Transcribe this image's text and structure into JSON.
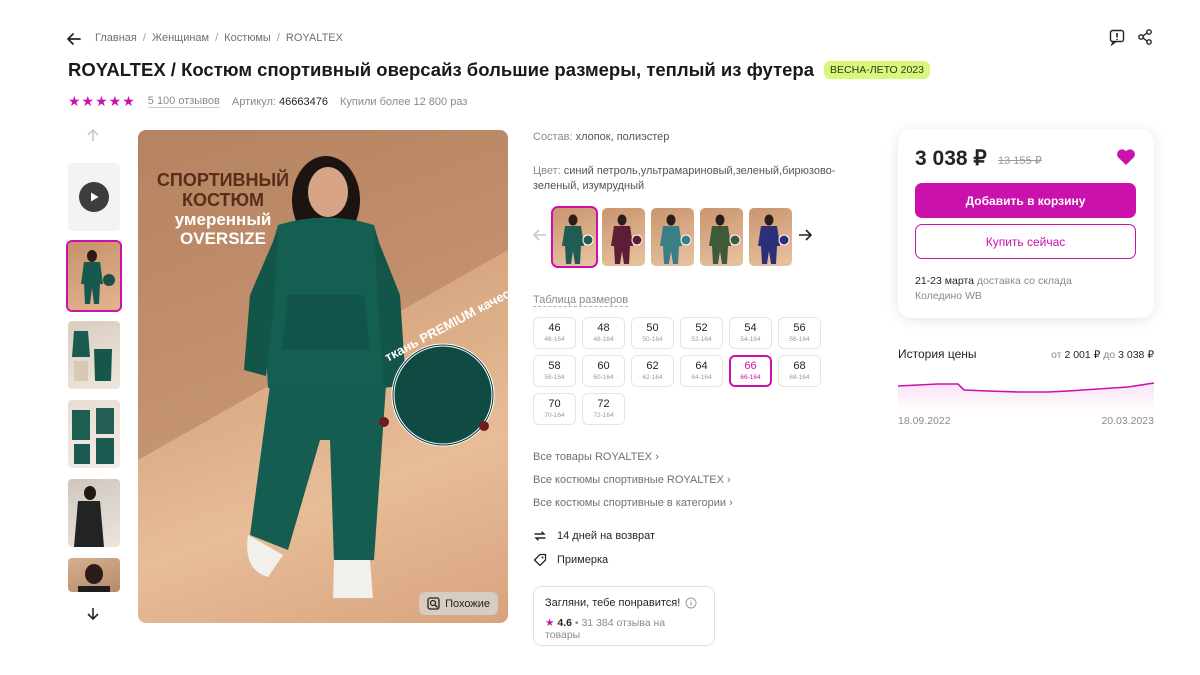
{
  "breadcrumbs": [
    "Главная",
    "Женщинам",
    "Костюмы",
    "ROYALTEX"
  ],
  "title": "ROYALTEX / Костюм спортивный оверсайз большие размеры, теплый из футера",
  "season_badge": "ВЕСНА-ЛЕТО 2023",
  "rating": {
    "stars": 5,
    "reviews": "5 100 отзывов"
  },
  "article": {
    "label": "Артикул:",
    "value": "46663476"
  },
  "bought": "Купили более 12 800 раз",
  "main_image": {
    "promo_lines": [
      "СПОРТИВНЫЙ",
      "КОСТЮМ",
      "умеренный",
      "OVERSIZE"
    ],
    "badge_text": "ткань PREMIUM качества без начеса",
    "similar_button": "Похожие"
  },
  "composition": {
    "label": "Состав:",
    "value": "хлопок, полиэстер"
  },
  "color": {
    "label": "Цвет:",
    "value": "синий петроль,ультрамариновый,зеленый,бирюзово-зеленый, изумрудный"
  },
  "color_variants": [
    {
      "name": "green",
      "color": "#1f5d52",
      "active": true
    },
    {
      "name": "burgundy",
      "color": "#5b1e36",
      "active": false
    },
    {
      "name": "teal",
      "color": "#3b7f86",
      "active": false
    },
    {
      "name": "olive",
      "color": "#3e5a3a",
      "active": false
    },
    {
      "name": "navy",
      "color": "#2c2f7a",
      "active": false
    }
  ],
  "size_table_label": "Таблица размеров",
  "sizes": [
    {
      "n": "46",
      "r": "46-164",
      "selected": false
    },
    {
      "n": "48",
      "r": "48-164",
      "selected": false
    },
    {
      "n": "50",
      "r": "50-164",
      "selected": false
    },
    {
      "n": "52",
      "r": "52-164",
      "selected": false
    },
    {
      "n": "54",
      "r": "54-164",
      "selected": false
    },
    {
      "n": "56",
      "r": "56-164",
      "selected": false
    },
    {
      "n": "58",
      "r": "58-164",
      "selected": false
    },
    {
      "n": "60",
      "r": "60-164",
      "selected": false
    },
    {
      "n": "62",
      "r": "62-164",
      "selected": false
    },
    {
      "n": "64",
      "r": "64-164",
      "selected": false
    },
    {
      "n": "66",
      "r": "66-164",
      "selected": true
    },
    {
      "n": "68",
      "r": "68-164",
      "selected": false
    },
    {
      "n": "70",
      "r": "70-164",
      "selected": false
    },
    {
      "n": "72",
      "r": "72-164",
      "selected": false
    }
  ],
  "links": [
    "Все товары ROYALTEX ›",
    "Все костюмы спортивные ROYALTEX ›",
    "Все костюмы спортивные в категории ›"
  ],
  "features": {
    "return": "14 дней на возврат",
    "fitting": "Примерка"
  },
  "promo_card": {
    "title": "Загляни, тебе понравится!",
    "rating": "4.6",
    "reviews": "• 31 384 отзыва на товары"
  },
  "price_card": {
    "price": "3 038 ₽",
    "old_price": "13 155 ₽",
    "add_to_cart": "Добавить в корзину",
    "buy_now": "Купить сейчас",
    "delivery_date": "21-23 марта",
    "delivery_text": "доставка со склада",
    "warehouse": "Коледино WB",
    "accent_color": "#cb11ab"
  },
  "price_history": {
    "title": "История цены",
    "from_label": "от",
    "from": "2 001 ₽",
    "to_label": "до",
    "to": "3 038 ₽",
    "start_date": "18.09.2022",
    "end_date": "20.03.2023"
  }
}
